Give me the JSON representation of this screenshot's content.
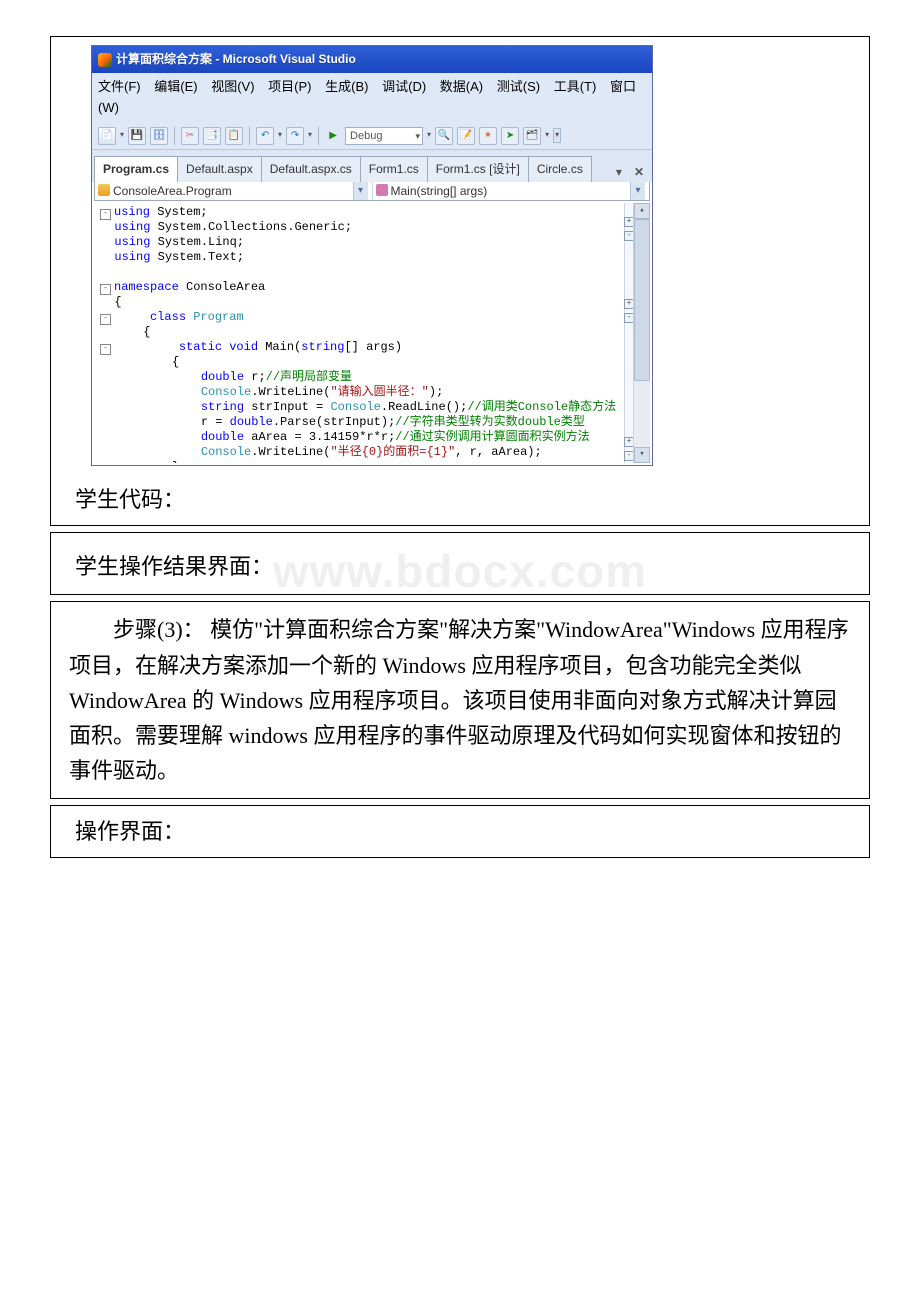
{
  "vs": {
    "title": "计算面积综合方案 - Microsoft Visual Studio",
    "menus": [
      "文件(F)",
      "编辑(E)",
      "视图(V)",
      "项目(P)",
      "生成(B)",
      "调试(D)",
      "数据(A)",
      "测试(S)",
      "工具(T)",
      "窗口(W)"
    ],
    "toolbar": {
      "config": "Debug"
    },
    "tabs": [
      "Program.cs",
      "Default.aspx",
      "Default.aspx.cs",
      "Form1.cs",
      "Form1.cs [设计]",
      "Circle.cs"
    ],
    "activeTab": 0,
    "nav": {
      "left": "ConsoleArea.Program",
      "right": "Main(string[] args)"
    },
    "code": "using System;\nusing System.Collections.Generic;\nusing System.Linq;\nusing System.Text;\n\nnamespace ConsoleArea\n{\n    class Program\n    {\n        static void Main(string[] args)\n        {\n            double r;//声明局部变量\n            Console.WriteLine(\"请输入圆半径：\");\n            string strInput = Console.ReadLine();//调用类Console静态方法\n            r = double.Parse(strInput);//字符串类型转为实数double类型\n            double aArea = 3.14159*r*r;//通过实例调用计算圆面积实例方法\n            Console.WriteLine(\"半径{0}的面积={1}\", r, aArea);\n        }\n    }\n}"
  },
  "sections": {
    "student_code": "学生代码：",
    "student_ui": "学生操作结果界面：",
    "watermark": "www.bdocx.com",
    "step3": "步骤(3)：  模仿\"计算面积综合方案\"解决方案\"WindowArea\"Windows 应用程序项目，在解决方案添加一个新的 Windows 应用程序项目，包含功能完全类似 WindowArea 的 Windows 应用程序项目。该项目使用非面向对象方式解决计算园面积。需要理解 windows 应用程序的事件驱动原理及代码如何实现窗体和按钮的事件驱动。",
    "ui_label": "操作界面："
  }
}
